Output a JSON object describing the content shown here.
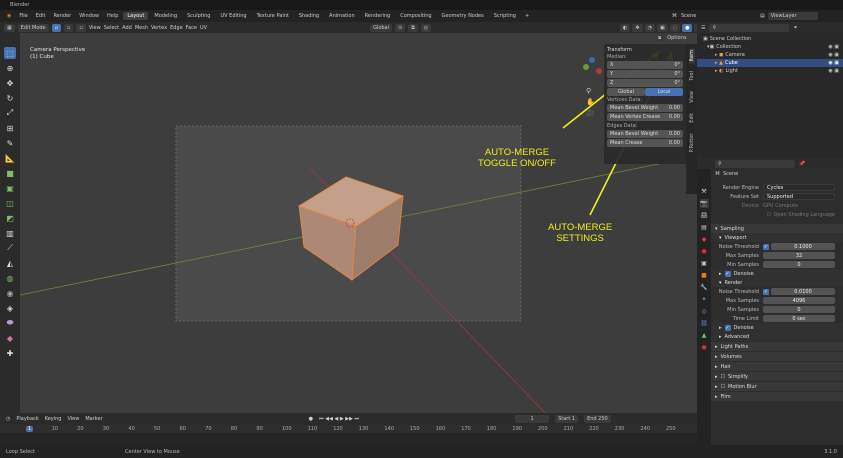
{
  "app": {
    "title": "Blender",
    "version": "3.1.0"
  },
  "menu": {
    "items": [
      "File",
      "Edit",
      "Render",
      "Window",
      "Help"
    ],
    "workspaces": [
      "Layout",
      "Modeling",
      "Sculpting",
      "UV Editing",
      "Texture Paint",
      "Shading",
      "Animation",
      "Rendering",
      "Compositing",
      "Geometry Nodes",
      "Scripting"
    ],
    "active_workspace": "Layout",
    "scene": "Scene",
    "view_layer": "ViewLayer"
  },
  "viewport_header": {
    "mode": "Edit Mode",
    "menus": [
      "View",
      "Select",
      "Add",
      "Mesh",
      "Vertex",
      "Edge",
      "Face",
      "UV"
    ],
    "transform": "Global",
    "options": "Options"
  },
  "overlay": {
    "line1": "Camera Perspective",
    "line2": "(1) Cube"
  },
  "npanel": {
    "title": "Transform",
    "median": "Median:",
    "x": {
      "label": "X",
      "value": "0°"
    },
    "y": {
      "label": "Y",
      "value": "0°"
    },
    "z": {
      "label": "Z",
      "value": "0°"
    },
    "global": "Global",
    "local": "Local",
    "vertices_data": "Vertices Data:",
    "mean_bevel_weight": {
      "label": "Mean Bevel Weight",
      "value": "0.00"
    },
    "mean_vertex_crease": {
      "label": "Mean Vertex Crease",
      "value": "0.00"
    },
    "edges_data": "Edges Data:",
    "edge_bevel_weight": {
      "label": "Mean Bevel Weight",
      "value": "0.00"
    },
    "edge_crease": {
      "label": "Mean Crease",
      "value": "0.00"
    },
    "tabs": [
      "Item",
      "Tool",
      "View",
      "Edit",
      "P.Rotter"
    ]
  },
  "annotations": {
    "toggle": [
      "AUTO-MERGE",
      "TOGGLE ON/OFF"
    ],
    "settings": [
      "AUTO-MERGE",
      "SETTINGS"
    ],
    "color": "#f2ee1a"
  },
  "timeline": {
    "menus": [
      "Playback",
      "Keying",
      "View",
      "Marker"
    ],
    "current_frame": "1",
    "start_label": "Start",
    "start": "1",
    "end_label": "End",
    "end": "250",
    "ticks": [
      "1",
      "10",
      "20",
      "30",
      "40",
      "50",
      "60",
      "70",
      "80",
      "90",
      "100",
      "110",
      "120",
      "130",
      "140",
      "150",
      "160",
      "170",
      "180",
      "190",
      "200",
      "210",
      "220",
      "230",
      "240",
      "250"
    ]
  },
  "status": {
    "left": "Loop Select",
    "mid": "Center View to Mouse"
  },
  "outliner": {
    "root": "Scene Collection",
    "collection": "Collection",
    "items": [
      "Camera",
      "Cube",
      "Light"
    ]
  },
  "properties": {
    "scene": "Scene",
    "render_engine": {
      "label": "Render Engine",
      "value": "Cycles"
    },
    "feature_set": {
      "label": "Feature Set",
      "value": "Supported"
    },
    "device": {
      "label": "Device",
      "value": "GPU Compute"
    },
    "osl": "Open Shading Language",
    "sampling": "Sampling",
    "viewport": "Viewport",
    "noise_threshold": {
      "label": "Noise Threshold",
      "value": "0.1000"
    },
    "max_samples": {
      "label": "Max Samples",
      "value": "32"
    },
    "min_samples": {
      "label": "Min Samples",
      "value": "0"
    },
    "denoise": "Denoise",
    "render": "Render",
    "r_noise_threshold": {
      "label": "Noise Threshold",
      "value": "0.0100"
    },
    "r_max_samples": {
      "label": "Max Samples",
      "value": "4096"
    },
    "r_min_samples": {
      "label": "Min Samples",
      "value": "0"
    },
    "time_limit": {
      "label": "Time Limit",
      "value": "0 sec"
    },
    "r_denoise": "Denoise",
    "advanced": "Advanced",
    "light_paths": "Light Paths",
    "volumes": "Volumes",
    "hair": "Hair",
    "simplify": "Simplify",
    "motion_blur": "Motion Blur",
    "film": "Film"
  }
}
